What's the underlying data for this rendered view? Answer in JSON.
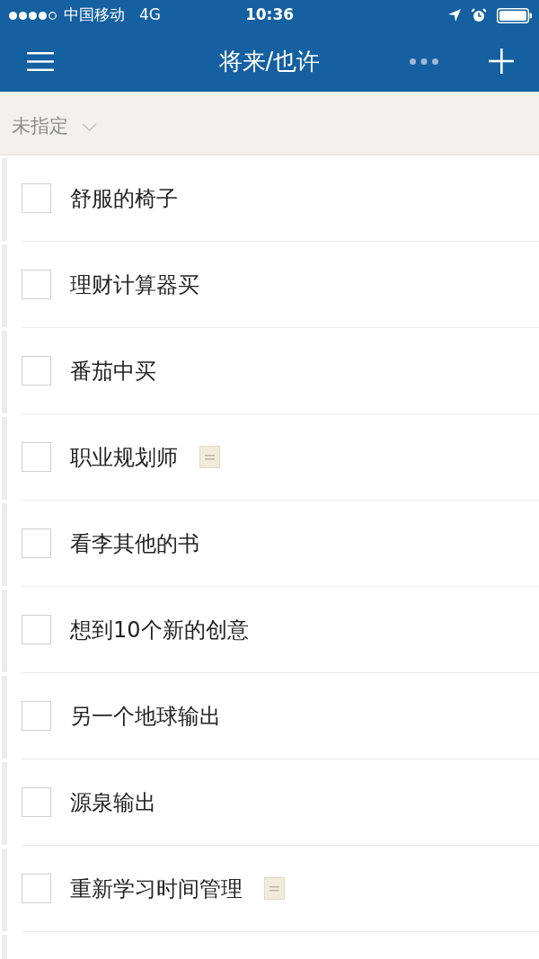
{
  "status_bar": {
    "carrier": "中国移动",
    "network": "4G",
    "time": "10:36"
  },
  "nav": {
    "title": "将来/也许"
  },
  "section": {
    "title": "未指定"
  },
  "tasks": [
    {
      "title": "舒服的椅子",
      "checked": false,
      "has_note": false
    },
    {
      "title": "理财计算器买",
      "checked": false,
      "has_note": false
    },
    {
      "title": "番茄中买",
      "checked": false,
      "has_note": false
    },
    {
      "title": "职业规划师",
      "checked": false,
      "has_note": true
    },
    {
      "title": "看李其他的书",
      "checked": false,
      "has_note": false
    },
    {
      "title": "想到10个新的创意",
      "checked": false,
      "has_note": false
    },
    {
      "title": "另一个地球输出",
      "checked": false,
      "has_note": false
    },
    {
      "title": "源泉输出",
      "checked": false,
      "has_note": false
    },
    {
      "title": "重新学习时间管理",
      "checked": false,
      "has_note": true
    }
  ]
}
